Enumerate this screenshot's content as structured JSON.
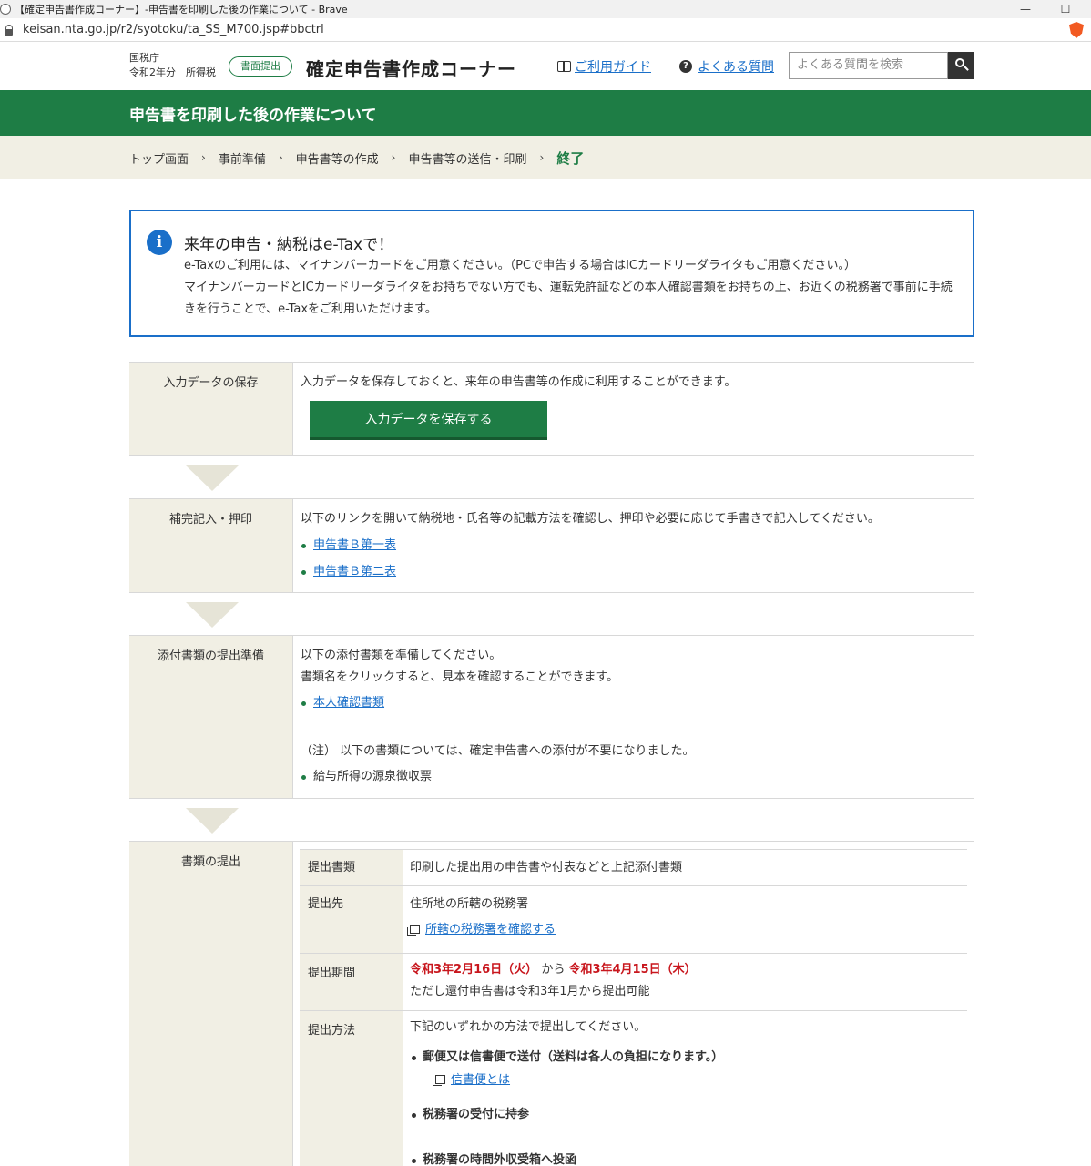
{
  "browser": {
    "window_title": "【確定申告書作成コーナー】-申告書を印刷した後の作業について - Brave",
    "url": "keisan.nta.go.jp/r2/syotoku/ta_SS_M700.jsp#bbctrl",
    "minimize": "—",
    "maximize": "☐"
  },
  "header": {
    "agency": "国税庁",
    "year_tax": "令和2年分　所得税",
    "pill": "書面提出",
    "title": "確定申告書作成コーナー",
    "guide_link": "ご利用ガイド",
    "faq_link": "よくある質問",
    "search_placeholder": "よくある質問を検索"
  },
  "banner": {
    "title": "申告書を印刷した後の作業について"
  },
  "breadcrumb": {
    "items": [
      "トップ画面",
      "事前準備",
      "申告書等の作成",
      "申告書等の送信・印刷"
    ],
    "current": "終了",
    "separator": "›"
  },
  "info": {
    "icon": "i",
    "title": "来年の申告・納税はe-Taxで！",
    "line1": "e-Taxのご利用には、マイナンバーカードをご用意ください。（PCで申告する場合はICカードリーダライタもご用意ください。）",
    "line2": "マイナンバーカードとICカードリーダライタをお持ちでない方でも、運転免許証などの本人確認書類をお持ちの上、お近くの税務署で事前に手続きを行うことで、e-Taxをご利用いただけます。"
  },
  "sections": {
    "save": {
      "label": "入力データの保存",
      "text": "入力データを保存しておくと、来年の申告書等の作成に利用することができます。",
      "button": "入力データを保存する"
    },
    "fill": {
      "label": "補完記入・押印",
      "text": "以下のリンクを開いて納税地・氏名等の記載方法を確認し、押印や必要に応じて手書きで記入してください。",
      "links": [
        "申告書Ｂ第一表",
        "申告書Ｂ第二表"
      ]
    },
    "attach": {
      "label": "添付書類の提出準備",
      "text1": "以下の添付書類を準備してください。",
      "text2": "書類名をクリックすると、見本を確認することができます。",
      "link": "本人確認書類",
      "note": "（注） 以下の書類については、確定申告書への添付が不要になりました。",
      "item": "給与所得の源泉徴収票"
    },
    "submit": {
      "label": "書類の提出",
      "rows": {
        "docs_h": "提出書類",
        "docs_d": "印刷した提出用の申告書や付表などと上記添付書類",
        "dest_h": "提出先",
        "dest_d": "住所地の所轄の税務署",
        "dest_link": "所轄の税務署を確認する",
        "period_h": "提出期間",
        "period_start": "令和3年2月16日（火）",
        "period_from": " から ",
        "period_end": "令和3年4月15日（木）",
        "period_note": "ただし還付申告書は令和3年1月から提出可能",
        "method_h": "提出方法",
        "method_intro": "下記のいずれかの方法で提出してください。",
        "method1": "郵便又は信書便で送付（送料は各人の負担になります。）",
        "method1_link": "信書便とは",
        "method2": "税務署の受付に持参",
        "method3": "税務署の時間外収受箱へ投函"
      }
    }
  }
}
